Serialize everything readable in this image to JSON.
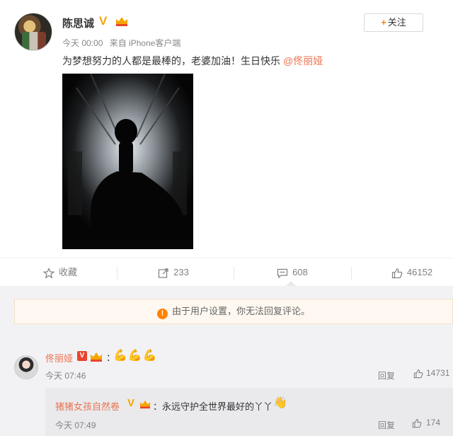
{
  "post": {
    "username": "陈思诚",
    "verified_badge": "V",
    "meta": {
      "time": "今天 00:00",
      "source": "来自 iPhone客户端"
    },
    "follow_label": "关注",
    "follow_symbol": "+",
    "text": "为梦想努力的人都是最棒的，老婆加油！生日快乐",
    "mention": "@佟丽娅"
  },
  "actions": {
    "favorite_label": "收藏",
    "repost_count": "233",
    "comment_count": "608",
    "like_count": "46152"
  },
  "notice": {
    "icon": "!",
    "text": "由于用户设置，你无法回复评论。"
  },
  "comment": {
    "author": "佟丽娅",
    "verified_badge": "V",
    "colon": "：",
    "emoji_text": "💪💪💪",
    "time": "今天 07:46",
    "reply_label": "回复",
    "likes": "14731"
  },
  "sub_comment": {
    "author": "猪猪女孩自然卷",
    "verified_badge": "V",
    "text": "：永远守护全世界最好的丫丫",
    "emoji_text": "👋",
    "time": "今天 07:49",
    "reply_label": "回复",
    "likes": "174"
  },
  "colors": {
    "accent": "#ff8200",
    "link": "#eb7350",
    "verified": "#f5a500"
  },
  "icons": [
    "star-icon",
    "repost-icon",
    "comment-icon",
    "like-icon",
    "warning-icon",
    "crown-icon"
  ]
}
